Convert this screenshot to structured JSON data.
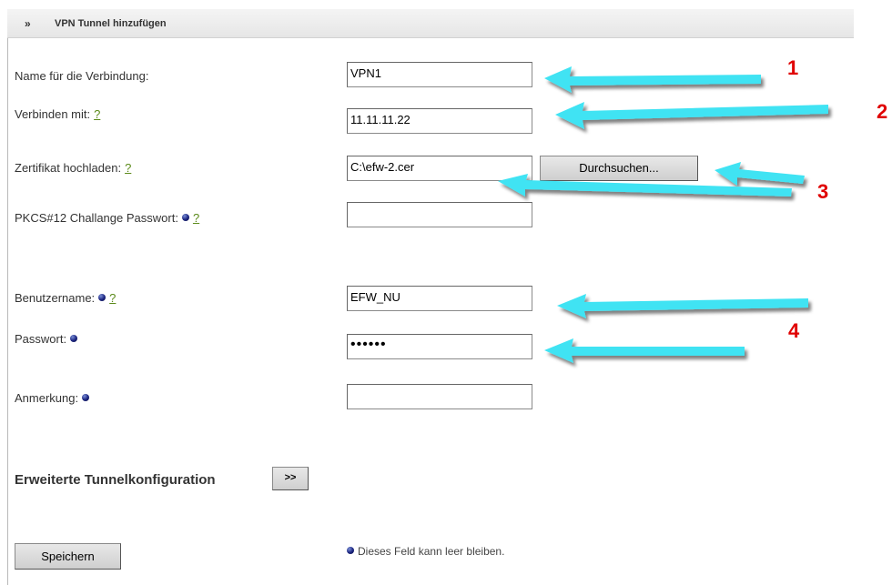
{
  "header": {
    "chevron": "»",
    "title": "VPN Tunnel hinzufügen"
  },
  "help_mark": "?",
  "fields": {
    "name": {
      "label": "Name für die Verbindung:",
      "value": "VPN1"
    },
    "connect": {
      "label": "Verbinden mit:",
      "value": "11.11.11.22"
    },
    "cert": {
      "label": "Zertifikat hochladen:",
      "value": "C:\\efw-2.cer",
      "browse_label": "Durchsuchen..."
    },
    "pkcs": {
      "label": "PKCS#12 Challange Passwort:",
      "value": ""
    },
    "username": {
      "label": "Benutzername:",
      "value": "EFW_NU"
    },
    "password": {
      "label": "Passwort:",
      "value": "••••••"
    },
    "note": {
      "label": "Anmerkung:",
      "value": ""
    }
  },
  "advanced": {
    "label": "Erweiterte Tunnelkonfiguration",
    "button": ">>"
  },
  "save_button": "Speichern",
  "optional_hint": "Dieses Feld kann leer bleiben.",
  "annotations": {
    "n1": "1",
    "n2": "2",
    "n3": "3",
    "n4": "4"
  },
  "colors": {
    "arrow": "#3fe3f3",
    "annotation_number": "#e00000",
    "help_link": "#5b8a1a",
    "optional_dot": "#1a237e"
  }
}
